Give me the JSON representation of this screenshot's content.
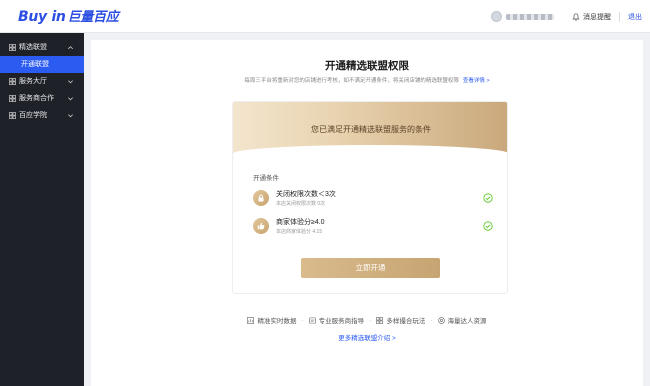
{
  "header": {
    "logo_text": "Buy in",
    "logo_cn": "巨量百应",
    "notifications_label": "消息提醒",
    "logout_label": "退出"
  },
  "sidebar": {
    "items": [
      {
        "label": "精选联盟",
        "expanded": true
      },
      {
        "label": "开通联盟",
        "active": true
      },
      {
        "label": "服务大厅"
      },
      {
        "label": "服务商合作"
      },
      {
        "label": "百应学院"
      }
    ]
  },
  "main": {
    "title": "开通精选联盟权限",
    "subtitle": "每周三平台将重新对您的店铺进行考核，如不满足开通条件，将关闭店铺的精选联盟权限",
    "details_link": "查看详情 >",
    "banner_text": "您已满足开通精选联盟服务的条件",
    "conditions_title": "开通条件",
    "conditions": [
      {
        "name": "关闭权限次数＜3次",
        "sub": "本店关闭权限次数 0次",
        "icon": "lock-icon",
        "met": true
      },
      {
        "name": "商家体验分≥4.0",
        "sub": "本店商家体验分 4.15",
        "icon": "thumbs-up-icon",
        "met": true
      }
    ],
    "open_button": "立即开通",
    "features": [
      "精准实时数据",
      "专业服务商指导",
      "多样撮合玩法",
      "海量达人资源"
    ],
    "more_link": "更多精选联盟介绍 >"
  },
  "colors": {
    "brand": "#2b4fe3",
    "active_nav": "#2b5bf0",
    "sidebar_bg": "#1f2129",
    "gold": "#c9a87b",
    "check": "#52c41a"
  }
}
